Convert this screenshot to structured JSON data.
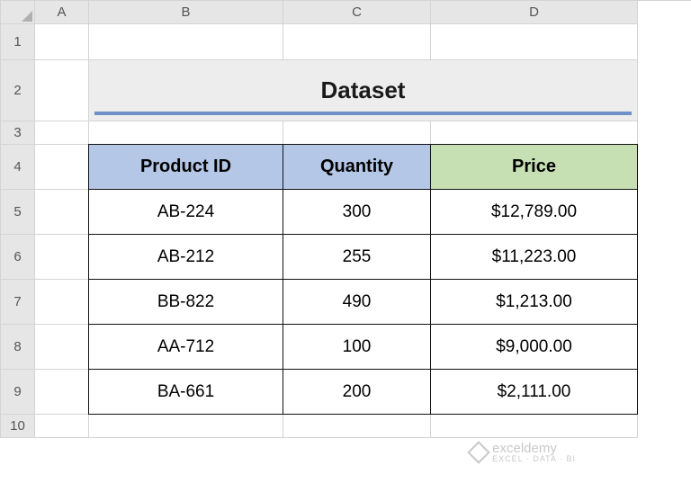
{
  "columns": [
    "A",
    "B",
    "C",
    "D"
  ],
  "rows": [
    "1",
    "2",
    "3",
    "4",
    "5",
    "6",
    "7",
    "8",
    "9",
    "10"
  ],
  "title": "Dataset",
  "headers": {
    "product_id": "Product ID",
    "quantity": "Quantity",
    "price": "Price"
  },
  "data": [
    {
      "id": "AB-224",
      "qty": "300",
      "price": "$12,789.00"
    },
    {
      "id": "AB-212",
      "qty": "255",
      "price": "$11,223.00"
    },
    {
      "id": "BB-822",
      "qty": "490",
      "price": "$1,213.00"
    },
    {
      "id": "AA-712",
      "qty": "100",
      "price": "$9,000.00"
    },
    {
      "id": "BA-661",
      "qty": "200",
      "price": "$2,111.00"
    }
  ],
  "watermark": {
    "brand": "exceldemy",
    "tagline": "EXCEL · DATA · BI"
  }
}
